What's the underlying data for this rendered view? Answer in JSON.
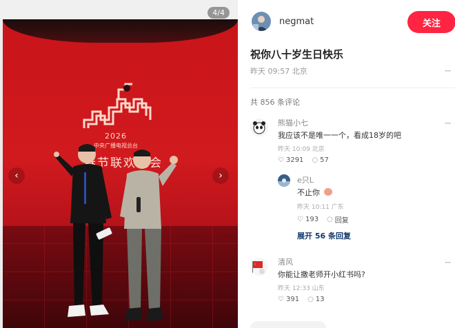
{
  "image_viewer": {
    "counter": "4/4",
    "stage_text": {
      "year": "2026",
      "organization": "中央广播电视总台",
      "title": "春节联欢晚会"
    }
  },
  "post": {
    "author": "negmat",
    "follow_label": "关注",
    "title": "祝你八十岁生日快乐",
    "meta": "昨天 09:57 北京",
    "comment_count": "共 856 条评论"
  },
  "comments": [
    {
      "name": "熊猫小七",
      "text": "我应该不是唯一一个，看成18岁的吧",
      "time": "昨天 10:09 北京",
      "likes": "3291",
      "replies": "57",
      "sub_replies": [
        {
          "name": "e只L",
          "text": "不止你",
          "time": "昨天 10:11 广东",
          "likes": "193",
          "replies": "回复"
        }
      ],
      "expand_label": "展开 56 条回复"
    },
    {
      "name": "清风",
      "text": "你能让撒老师开小红书吗?",
      "time": "昨天 12:33 山东",
      "likes": "391",
      "replies": "13"
    }
  ],
  "colors": {
    "accent": "#ff2442",
    "link": "#13386c",
    "stage_red": "#d11a1e"
  },
  "icons": {
    "like": "heart-outline-icon",
    "reply": "speech-bubble-icon",
    "more": "more-dots-icon",
    "prev": "chevron-left-icon",
    "next": "chevron-right-icon"
  }
}
